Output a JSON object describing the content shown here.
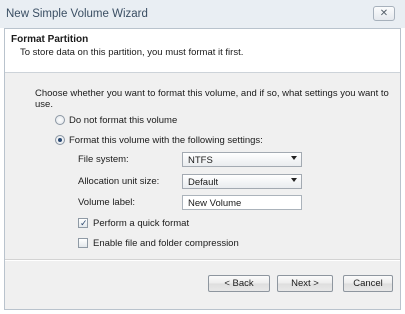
{
  "window": {
    "title": "New Simple Volume Wizard",
    "close_glyph": "✕"
  },
  "header": {
    "title": "Format Partition",
    "subtitle": "To store data on this partition, you must format it first."
  },
  "body": {
    "instruction": "Choose whether you want to format this volume, and if so, what settings you want to use.",
    "options": {
      "do_not_format": {
        "label": "Do not format this volume",
        "selected": false
      },
      "format_with_settings": {
        "label": "Format this volume with the following settings:",
        "selected": true
      }
    },
    "fields": {
      "file_system": {
        "label": "File system:",
        "value": "NTFS"
      },
      "allocation_unit_size": {
        "label": "Allocation unit size:",
        "value": "Default"
      },
      "volume_label": {
        "label": "Volume label:",
        "value": "New Volume"
      }
    },
    "checkboxes": {
      "quick_format": {
        "label": "Perform a quick format",
        "checked": true
      },
      "compression": {
        "label": "Enable file and folder compression",
        "checked": false
      }
    }
  },
  "footer": {
    "back_label": "< Back",
    "next_label": "Next >",
    "cancel_label": "Cancel"
  },
  "icons": {
    "checkmark": "✓"
  }
}
